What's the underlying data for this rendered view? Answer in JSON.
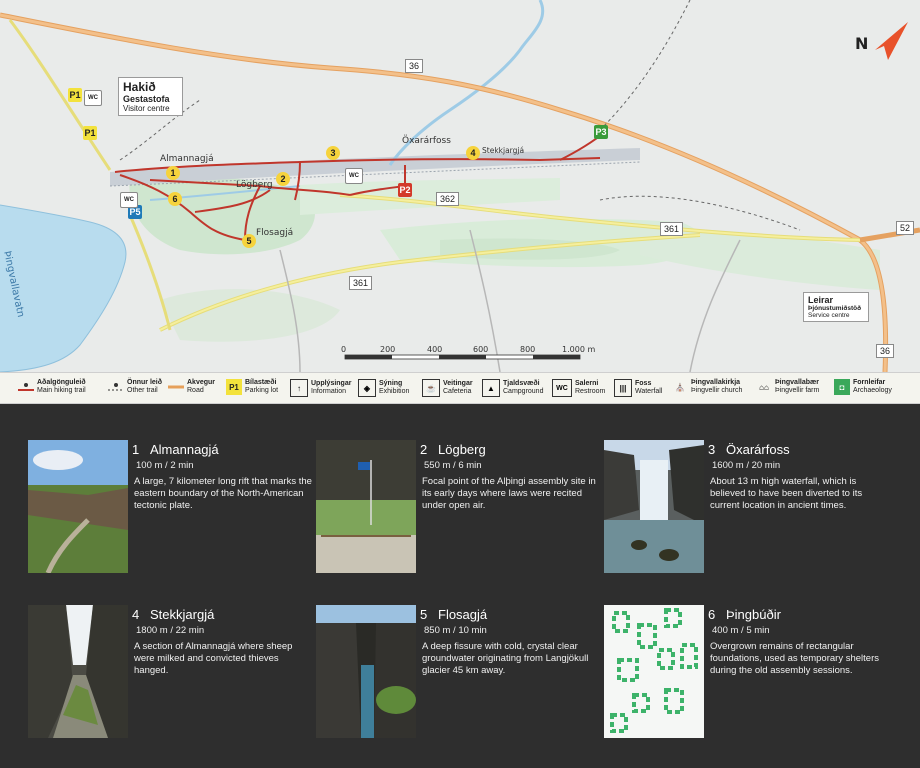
{
  "map": {
    "north_label": "N",
    "roads": {
      "r36a": "36",
      "r36b": "36",
      "r362": "362",
      "r361a": "361",
      "r361b": "361",
      "r52": "52"
    },
    "places": {
      "lake": "Þingvallavatn",
      "almannagja": "Almannagjá",
      "logberg": "Lögberg",
      "flosagja": "Flosagjá",
      "oxararfoss": "Öxarárfoss",
      "stekkjargja": "Stekkjargjá"
    },
    "markers": {
      "p1": "P1",
      "p1b": "P1",
      "p2": "P2",
      "p3": "P3",
      "p5": "P5",
      "wc": "WC",
      "s1": "1",
      "s2": "2",
      "s3": "3",
      "s4": "4",
      "s5": "5",
      "s6": "6"
    },
    "visitor_centre": {
      "name": "Hakið",
      "sub1": "Gestastofa",
      "sub2": "Visitor centre"
    },
    "service_centre": {
      "name": "Leirar",
      "sub1": "Þjónustumiðstöð",
      "sub2": "Service centre"
    },
    "scale": {
      "labels": [
        "0",
        "200",
        "400",
        "600",
        "800",
        "1.000 m"
      ]
    }
  },
  "legend": [
    {
      "icon": "main-trail-icon",
      "is": "Aðalgönguleið",
      "en": "Main hiking trail"
    },
    {
      "icon": "other-trail-icon",
      "is": "Önnur leið",
      "en": "Other trail"
    },
    {
      "icon": "road-icon",
      "is": "Akvegur",
      "en": "Road"
    },
    {
      "icon": "parking-icon",
      "is": "Bílastæði",
      "en": "Parking lot"
    },
    {
      "icon": "information-icon",
      "is": "Upplýsingar",
      "en": "Information"
    },
    {
      "icon": "exhibition-icon",
      "is": "Sýning",
      "en": "Exhibition"
    },
    {
      "icon": "cafeteria-icon",
      "is": "Veitingar",
      "en": "Cafeteria"
    },
    {
      "icon": "campground-icon",
      "is": "Tjaldsvæði",
      "en": "Campground"
    },
    {
      "icon": "restroom-icon",
      "is": "Salerni",
      "en": "Restroom"
    },
    {
      "icon": "waterfall-icon",
      "is": "Foss",
      "en": "Waterfall"
    },
    {
      "icon": "church-icon",
      "is": "Þingvallakirkja",
      "en": "Þingvellir church"
    },
    {
      "icon": "farm-icon",
      "is": "Þingvallabær",
      "en": "Þingvellir farm"
    },
    {
      "icon": "archaeology-icon",
      "is": "Fornleifar",
      "en": "Archaeology"
    }
  ],
  "legend_icon_text": {
    "parking": "P1",
    "wc": "WC"
  },
  "sites": [
    {
      "num": "1",
      "title": "Almannagjá",
      "dist": "100 m / 2 min",
      "desc": "A large, 7 kilometer long rift that marks the eastern boundary of the North-American tectonic plate."
    },
    {
      "num": "2",
      "title": "Lögberg",
      "dist": "550 m / 6 min",
      "desc": "Focal point of the Alþingi assembly site in its early days where laws were recited under open air."
    },
    {
      "num": "3",
      "title": "Öxarárfoss",
      "dist": "1600 m / 20 min",
      "desc": "About 13 m high waterfall, which is believed to have been diverted to its current location in ancient times."
    },
    {
      "num": "4",
      "title": "Stekkjargjá",
      "dist": "1800 m / 22 min",
      "desc": "A section of Almannagjá where sheep were milked and convicted thieves hanged."
    },
    {
      "num": "5",
      "title": "Flosagjá",
      "dist": "850 m / 10 min",
      "desc": "A deep fissure with cold, crystal clear groundwater originating from Langjökull glacier 45 km away."
    },
    {
      "num": "6",
      "title": "Þingbúðir",
      "dist": "400 m / 5 min",
      "desc": "Overgrown remains of rectangular foundations, used as temporary shelters during the old assembly sessions."
    }
  ]
}
